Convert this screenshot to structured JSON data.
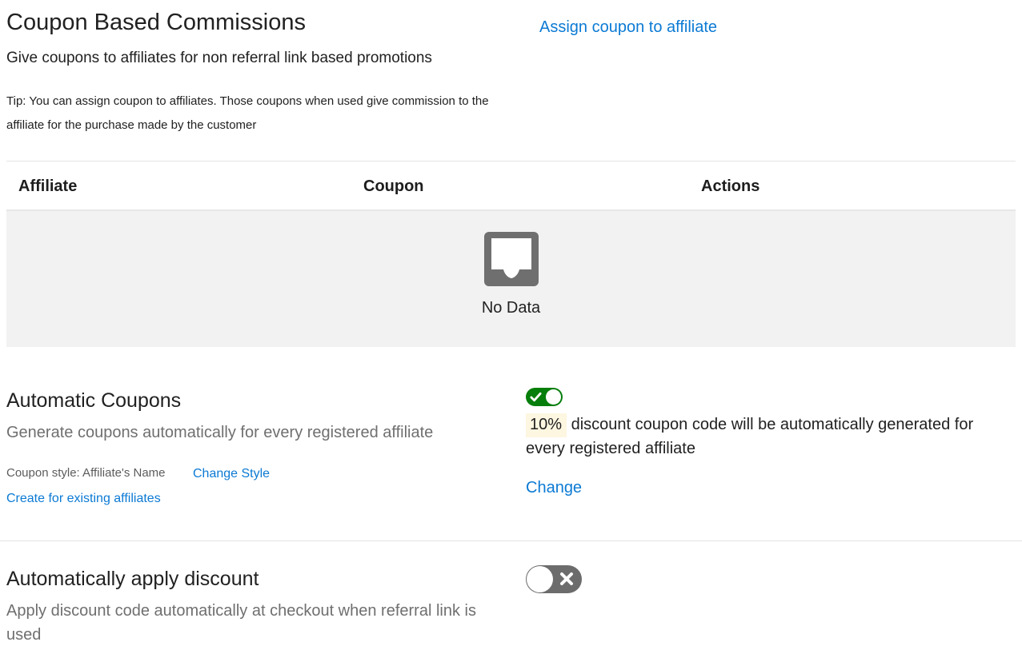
{
  "header": {
    "title": "Coupon Based Commissions",
    "subtitle": "Give coupons to affiliates for non referral link based promotions",
    "tip": "Tip: You can assign coupon to affiliates. Those coupons when used give commission to the affiliate for the purchase made by the customer",
    "assign_link": "Assign coupon to affiliate"
  },
  "table": {
    "columns": [
      "Affiliate",
      "Coupon",
      "Actions"
    ],
    "rows": [],
    "empty_text": "No Data",
    "empty_icon": "inbox-icon"
  },
  "automatic_coupons": {
    "title": "Automatic Coupons",
    "description": "Generate coupons automatically for every registered affiliate",
    "style_label": "Coupon style: Affiliate's Name",
    "change_style_link": "Change Style",
    "create_existing_link": "Create for existing affiliates",
    "toggle_enabled": true,
    "discount_percent": "10%",
    "discount_text": "discount coupon code will be automatically generated for every registered affiliate",
    "change_link": "Change"
  },
  "auto_apply_discount": {
    "title": "Automatically apply discount",
    "description": "Apply discount code automatically at checkout when referral link is used",
    "toggle_enabled": false
  },
  "colors": {
    "link": "#0b7ad4",
    "toggle_on": "#067e0b",
    "toggle_off": "#6c6c6c",
    "empty_bg": "#f2f2f2",
    "badge_bg": "#fdf6e0"
  }
}
